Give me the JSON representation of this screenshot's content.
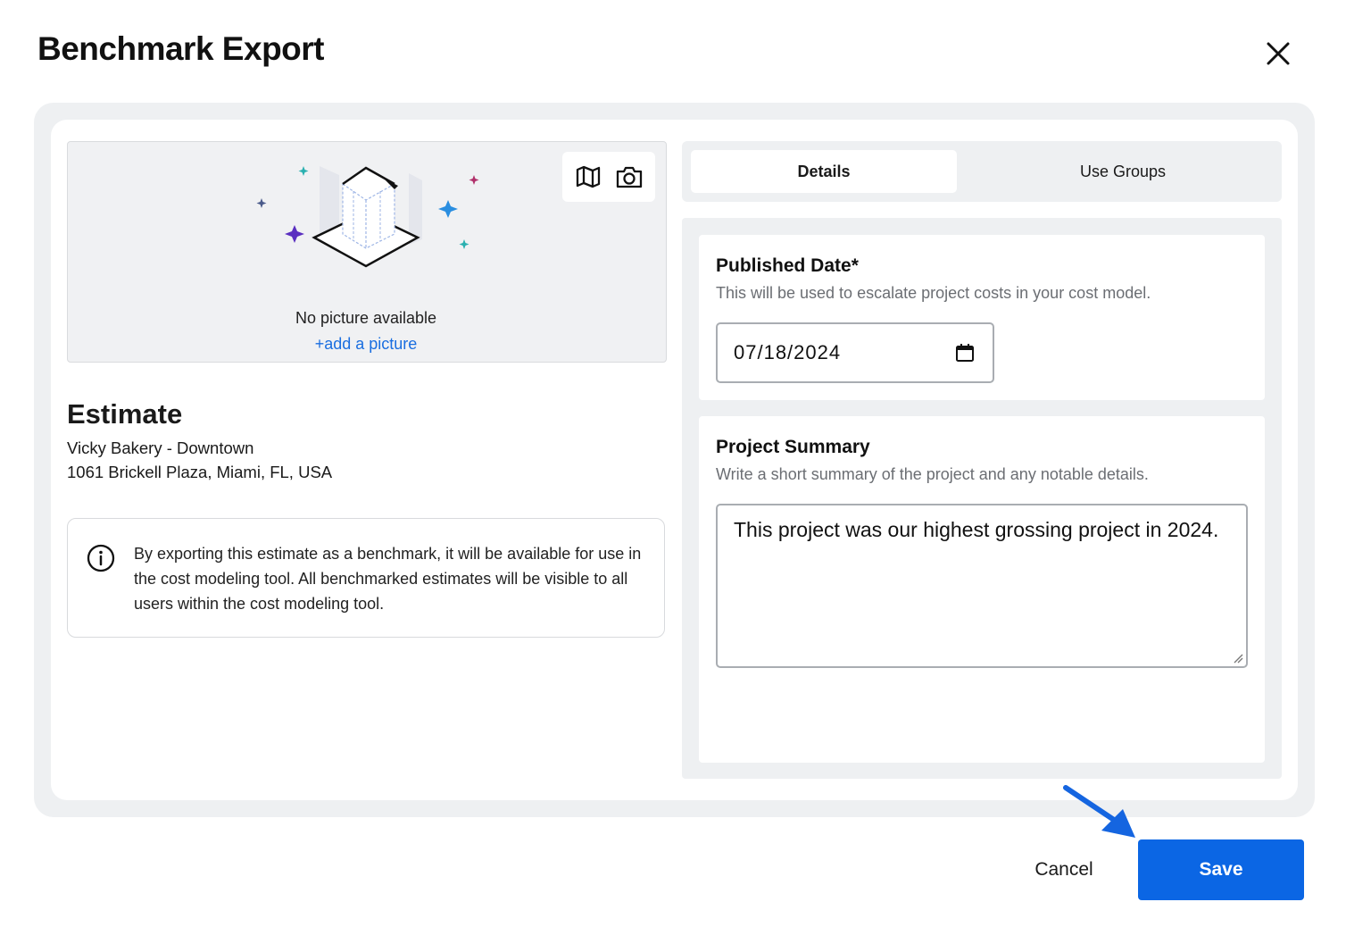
{
  "dialog": {
    "title": "Benchmark Export",
    "close_icon": "close-icon"
  },
  "picture": {
    "tools": [
      "map-icon",
      "camera-icon"
    ],
    "empty_text": "No picture available",
    "add_link": "+add a picture"
  },
  "estimate": {
    "heading": "Estimate",
    "project_name": "Vicky Bakery - Downtown",
    "address": "1061 Brickell Plaza, Miami, FL, USA"
  },
  "info": {
    "icon": "info-icon",
    "text": "By exporting this estimate as a benchmark, it will be available for use in the cost modeling tool. All benchmarked estimates will be visible to all users within the cost modeling tool."
  },
  "tabs": [
    {
      "label": "Details",
      "active": true
    },
    {
      "label": "Use Groups",
      "active": false
    }
  ],
  "published_date": {
    "label": "Published Date*",
    "help": "This will be used to escalate project costs in your cost model.",
    "value": "07/18/2024",
    "icon": "calendar-icon"
  },
  "project_summary": {
    "label": "Project Summary",
    "help": "Write a short summary of the project and any notable details.",
    "value": "This project was our highest grossing project in 2024."
  },
  "footer": {
    "cancel_label": "Cancel",
    "save_label": "Save"
  },
  "colors": {
    "primary": "#0b66e4",
    "link": "#1a6ee0",
    "panel_bg": "#eef0f2",
    "arrow": "#1565e0"
  }
}
